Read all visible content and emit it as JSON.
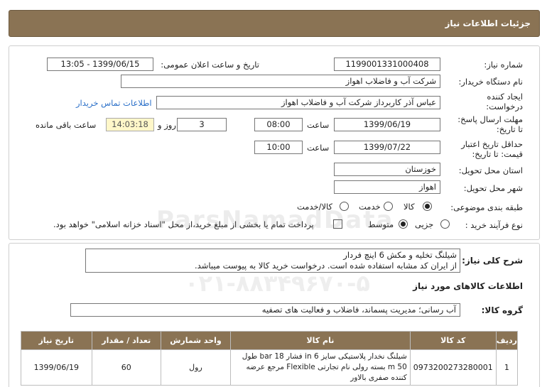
{
  "header": {
    "title": "جزئیات اطلاعات نیاز"
  },
  "info": {
    "need_number_label": "شماره نیاز:",
    "need_number": "1199001331000408",
    "announce_label": "تاریخ و ساعت اعلان عمومی:",
    "announce_value": "1399/06/15 - 13:05",
    "buyer_org_label": "نام دستگاه خریدار:",
    "buyer_org": "شرکت آب و فاضلاب اهواز",
    "creator_label_1": "ایجاد کننده",
    "creator_label_2": "درخواست:",
    "creator": "عباس آذر کاربرداز شرکت آب و فاضلاب اهواز",
    "contact_link": "اطلاعات تماس خریدار",
    "deadline_label_1": "مهلت ارسال پاسخ:",
    "deadline_label_2": "تا تاریخ:",
    "deadline_date": "1399/06/19",
    "time_label": "ساعت",
    "deadline_time": "08:00",
    "days": "3",
    "days_label": "روز و",
    "remaining_time": "14:03:18",
    "remaining_label": "ساعت باقی مانده",
    "validity_label_1": "حداقل تاریخ اعتبار",
    "validity_label_2": "قیمت: تا تاریخ:",
    "validity_date": "1399/07/22",
    "validity_time": "10:00",
    "province_label": "استان محل تحویل:",
    "province": "خوزستان",
    "city_label": "شهر محل تحویل:",
    "city": "اهواز",
    "category_label": "طبقه بندی موضوعی:",
    "category_options": [
      "کالا",
      "خدمت",
      "کالا/خدمت"
    ],
    "process_label": "نوع فرآیند خرید :",
    "process_options": [
      "جزیی",
      "متوسط"
    ],
    "payment_note": "پرداخت تمام یا بخشی از مبلغ خرید،از محل \"اسناد خزانه اسلامی\" خواهد بود."
  },
  "summary": {
    "label": "شرح کلی نیاز:",
    "line1": "شیلنگ تخلیه و مکش 6 اینچ فردار",
    "line2": "از ایران کد مشابه استفاده شده است. درخواست خرید کالا به پیوست میباشد.",
    "goods_title": "اطلاعات کالاهای مورد نیاز",
    "group_label": "گروه کالا:",
    "group_value": "آب رسانی؛ مدیریت پسماند، فاضلاب و فعالیت های تصفیه"
  },
  "table": {
    "headers": [
      "ردیف",
      "کد کالا",
      "نام کالا",
      "واحد شمارش",
      "تعداد / مقدار",
      "تاریخ نیاز"
    ],
    "rows": [
      {
        "row": "1",
        "code": "0973200273280001",
        "name": "شیلنگ نخدار پلاستیکی سایز 6 in فشار 18 bar طول 50 m بسته رولی نام تجارتی Flexible مرجع عرضه کننده صفری بالاور",
        "unit": "رول",
        "qty": "60",
        "date": "1399/06/19"
      }
    ]
  },
  "watermark": {
    "text1": "ParsNamadData",
    "text2": "۰۲۱-۸۸۳۴۹۶۷۰-۵"
  }
}
